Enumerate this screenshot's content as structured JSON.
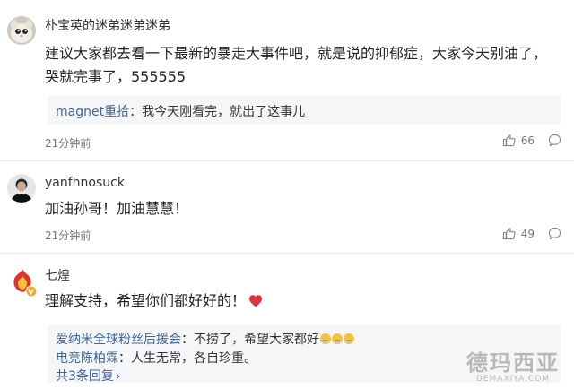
{
  "comments": [
    {
      "username": "朴宝英的迷弟迷弟迷弟",
      "text": "建议大家都去看一下最新的暴走大事件吧，就是说的抑郁症，大家今天别油了，哭就完事了，555555",
      "replies": [
        {
          "user": "magnet重拾",
          "sep": "：",
          "text": "我今天刚看完，就出了这事儿"
        }
      ],
      "time": "21分钟前",
      "likes": "66"
    },
    {
      "username": "yanfhnosuck",
      "text": "加油孙哥！加油慧慧！",
      "time": "21分钟前",
      "likes": "49"
    },
    {
      "username": "七煌",
      "text": "理解支持，希望你们都好好的！",
      "replies": [
        {
          "user": "爱纳米全球粉丝后援会",
          "sep": "：",
          "text": "不捞了，希望大家都好"
        },
        {
          "user": "电竞陈柏霖",
          "sep": "：",
          "text": "人生无常，各自珍重。"
        }
      ],
      "more_replies": "共3条回复",
      "more_chevron": "›"
    }
  ],
  "icons": {
    "like": "thumbs-up-icon",
    "reply": "comment-bubble-icon",
    "heart": "red-heart-emoji",
    "crying": "crying-face-emoji",
    "verified": "verified-v-badge-icon"
  },
  "colors": {
    "link": "#406599",
    "reply_bg": "#f5f6f8",
    "heart": "#e0333a",
    "verified": "#f5a623"
  },
  "watermark": {
    "main": "德玛西亚",
    "sub": "DEMAXIYA.COM"
  }
}
